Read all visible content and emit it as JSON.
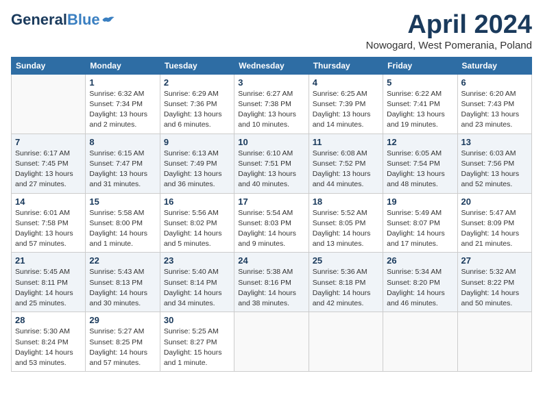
{
  "logo": {
    "general": "General",
    "blue": "Blue"
  },
  "title": "April 2024",
  "location": "Nowogard, West Pomerania, Poland",
  "weekdays": [
    "Sunday",
    "Monday",
    "Tuesday",
    "Wednesday",
    "Thursday",
    "Friday",
    "Saturday"
  ],
  "weeks": [
    [
      {
        "day": "",
        "info": ""
      },
      {
        "day": "1",
        "info": "Sunrise: 6:32 AM\nSunset: 7:34 PM\nDaylight: 13 hours\nand 2 minutes."
      },
      {
        "day": "2",
        "info": "Sunrise: 6:29 AM\nSunset: 7:36 PM\nDaylight: 13 hours\nand 6 minutes."
      },
      {
        "day": "3",
        "info": "Sunrise: 6:27 AM\nSunset: 7:38 PM\nDaylight: 13 hours\nand 10 minutes."
      },
      {
        "day": "4",
        "info": "Sunrise: 6:25 AM\nSunset: 7:39 PM\nDaylight: 13 hours\nand 14 minutes."
      },
      {
        "day": "5",
        "info": "Sunrise: 6:22 AM\nSunset: 7:41 PM\nDaylight: 13 hours\nand 19 minutes."
      },
      {
        "day": "6",
        "info": "Sunrise: 6:20 AM\nSunset: 7:43 PM\nDaylight: 13 hours\nand 23 minutes."
      }
    ],
    [
      {
        "day": "7",
        "info": "Sunrise: 6:17 AM\nSunset: 7:45 PM\nDaylight: 13 hours\nand 27 minutes."
      },
      {
        "day": "8",
        "info": "Sunrise: 6:15 AM\nSunset: 7:47 PM\nDaylight: 13 hours\nand 31 minutes."
      },
      {
        "day": "9",
        "info": "Sunrise: 6:13 AM\nSunset: 7:49 PM\nDaylight: 13 hours\nand 36 minutes."
      },
      {
        "day": "10",
        "info": "Sunrise: 6:10 AM\nSunset: 7:51 PM\nDaylight: 13 hours\nand 40 minutes."
      },
      {
        "day": "11",
        "info": "Sunrise: 6:08 AM\nSunset: 7:52 PM\nDaylight: 13 hours\nand 44 minutes."
      },
      {
        "day": "12",
        "info": "Sunrise: 6:05 AM\nSunset: 7:54 PM\nDaylight: 13 hours\nand 48 minutes."
      },
      {
        "day": "13",
        "info": "Sunrise: 6:03 AM\nSunset: 7:56 PM\nDaylight: 13 hours\nand 52 minutes."
      }
    ],
    [
      {
        "day": "14",
        "info": "Sunrise: 6:01 AM\nSunset: 7:58 PM\nDaylight: 13 hours\nand 57 minutes."
      },
      {
        "day": "15",
        "info": "Sunrise: 5:58 AM\nSunset: 8:00 PM\nDaylight: 14 hours\nand 1 minute."
      },
      {
        "day": "16",
        "info": "Sunrise: 5:56 AM\nSunset: 8:02 PM\nDaylight: 14 hours\nand 5 minutes."
      },
      {
        "day": "17",
        "info": "Sunrise: 5:54 AM\nSunset: 8:03 PM\nDaylight: 14 hours\nand 9 minutes."
      },
      {
        "day": "18",
        "info": "Sunrise: 5:52 AM\nSunset: 8:05 PM\nDaylight: 14 hours\nand 13 minutes."
      },
      {
        "day": "19",
        "info": "Sunrise: 5:49 AM\nSunset: 8:07 PM\nDaylight: 14 hours\nand 17 minutes."
      },
      {
        "day": "20",
        "info": "Sunrise: 5:47 AM\nSunset: 8:09 PM\nDaylight: 14 hours\nand 21 minutes."
      }
    ],
    [
      {
        "day": "21",
        "info": "Sunrise: 5:45 AM\nSunset: 8:11 PM\nDaylight: 14 hours\nand 25 minutes."
      },
      {
        "day": "22",
        "info": "Sunrise: 5:43 AM\nSunset: 8:13 PM\nDaylight: 14 hours\nand 30 minutes."
      },
      {
        "day": "23",
        "info": "Sunrise: 5:40 AM\nSunset: 8:14 PM\nDaylight: 14 hours\nand 34 minutes."
      },
      {
        "day": "24",
        "info": "Sunrise: 5:38 AM\nSunset: 8:16 PM\nDaylight: 14 hours\nand 38 minutes."
      },
      {
        "day": "25",
        "info": "Sunrise: 5:36 AM\nSunset: 8:18 PM\nDaylight: 14 hours\nand 42 minutes."
      },
      {
        "day": "26",
        "info": "Sunrise: 5:34 AM\nSunset: 8:20 PM\nDaylight: 14 hours\nand 46 minutes."
      },
      {
        "day": "27",
        "info": "Sunrise: 5:32 AM\nSunset: 8:22 PM\nDaylight: 14 hours\nand 50 minutes."
      }
    ],
    [
      {
        "day": "28",
        "info": "Sunrise: 5:30 AM\nSunset: 8:24 PM\nDaylight: 14 hours\nand 53 minutes."
      },
      {
        "day": "29",
        "info": "Sunrise: 5:27 AM\nSunset: 8:25 PM\nDaylight: 14 hours\nand 57 minutes."
      },
      {
        "day": "30",
        "info": "Sunrise: 5:25 AM\nSunset: 8:27 PM\nDaylight: 15 hours\nand 1 minute."
      },
      {
        "day": "",
        "info": ""
      },
      {
        "day": "",
        "info": ""
      },
      {
        "day": "",
        "info": ""
      },
      {
        "day": "",
        "info": ""
      }
    ]
  ]
}
